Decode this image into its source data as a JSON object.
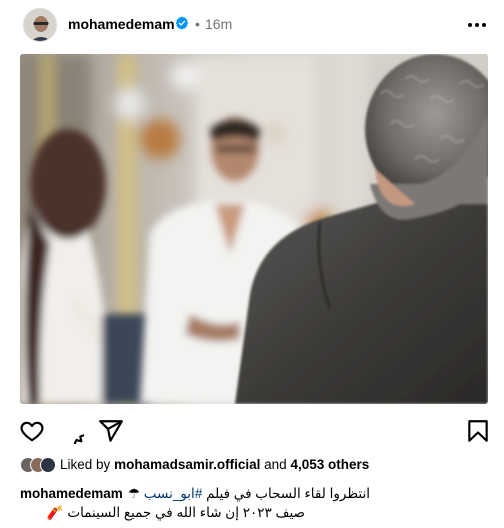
{
  "post": {
    "author": {
      "username": "mohamedemam",
      "verified": true,
      "separator": "•",
      "time_ago": "16m"
    },
    "icons": {
      "more": "more-horizontal-icon",
      "like": "heart-icon",
      "comment": "comment-icon",
      "share": "paper-plane-icon",
      "save": "bookmark-icon"
    },
    "likes": {
      "prefix": "Liked by",
      "liked_by": "mohamadsamir.official",
      "joiner": "and",
      "count_text": "4,053 others"
    },
    "caption": {
      "username": "mohamedemam",
      "line1_pre": "انتظروا لقاء السحاب في فيلم ",
      "hashtag": "#ابو_نسب",
      "line1_post": " ☂",
      "line2": "صيف ٢٠٢٣ إن شاء الله في جميع السينمات 🧨"
    },
    "colors": {
      "verified_badge": "#0095f6",
      "secondary_text": "#737373",
      "hashtag_link": "#00376b"
    }
  }
}
